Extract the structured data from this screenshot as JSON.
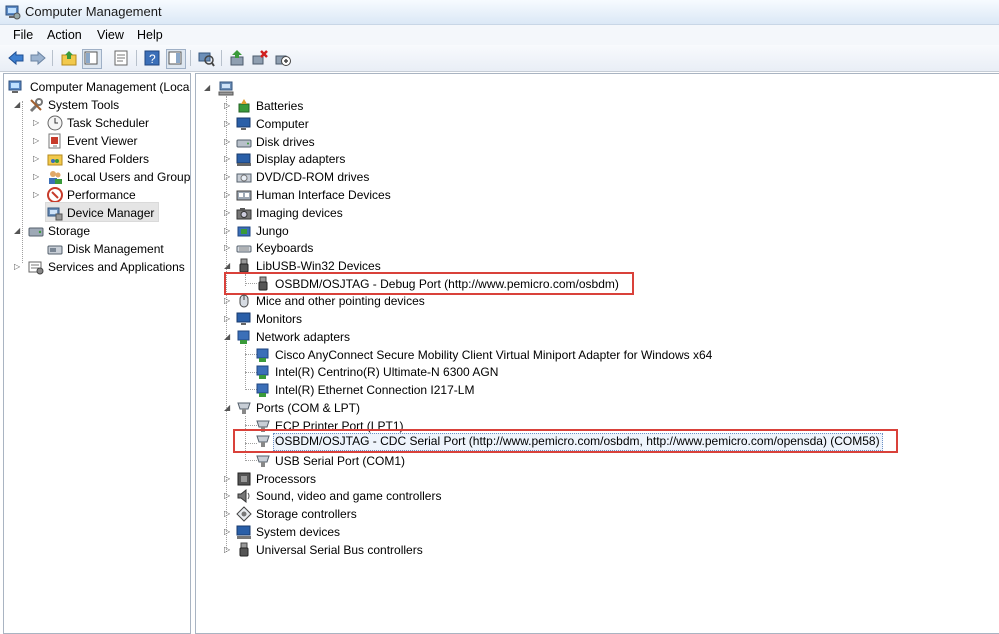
{
  "window": {
    "title": "Computer Management"
  },
  "menu": {
    "items": [
      "File",
      "Action",
      "View",
      "Help"
    ]
  },
  "toolbar": {
    "buttons": [
      "back-arrow-icon",
      "forward-arrow-icon",
      "up-folder-icon",
      "show-hide-tree-icon",
      "properties-icon",
      "help-icon",
      "show-action-pane-icon",
      "scan-hardware-icon",
      "update-driver-icon",
      "uninstall-device-icon",
      "disable-device-icon"
    ]
  },
  "left_tree": {
    "root": "Computer Management (Local",
    "system_tools": "System Tools",
    "task_scheduler": "Task Scheduler",
    "event_viewer": "Event Viewer",
    "shared_folders": "Shared Folders",
    "local_users": "Local Users and Groups",
    "performance": "Performance",
    "device_manager": "Device Manager",
    "storage": "Storage",
    "disk_management": "Disk Management",
    "services": "Services and Applications"
  },
  "devices": {
    "batteries": "Batteries",
    "computer": "Computer",
    "disk_drives": "Disk drives",
    "display_adapters": "Display adapters",
    "dvd": "DVD/CD-ROM drives",
    "hid": "Human Interface Devices",
    "imaging": "Imaging devices",
    "jungo": "Jungo",
    "keyboards": "Keyboards",
    "libusb": "LibUSB-Win32 Devices",
    "osbdm_debug": "OSBDM/OSJTAG - Debug Port (http://www.pemicro.com/osbdm)",
    "mice": "Mice and other pointing devices",
    "monitors": "Monitors",
    "network": "Network adapters",
    "cisco": "Cisco AnyConnect Secure Mobility Client Virtual Miniport Adapter for Windows x64",
    "intel_wifi": "Intel(R) Centrino(R) Ultimate-N 6300 AGN",
    "intel_eth": "Intel(R) Ethernet Connection I217-LM",
    "ports": "Ports (COM & LPT)",
    "ecp": "ECP Printer Port (LPT1)",
    "osbdm_cdc": "OSBDM/OSJTAG - CDC Serial Port (http://www.pemicro.com/osbdm, http://www.pemicro.com/opensda) (COM58)",
    "usb_serial": "USB Serial Port (COM1)",
    "processors": "Processors",
    "sound": "Sound, video and game controllers",
    "storage_ctrl": "Storage controllers",
    "system_devices": "System devices",
    "usb_ctrl": "Universal Serial Bus controllers"
  },
  "colors": {
    "highlight_border": "#d9413a",
    "selection": "#e5e5e5"
  }
}
